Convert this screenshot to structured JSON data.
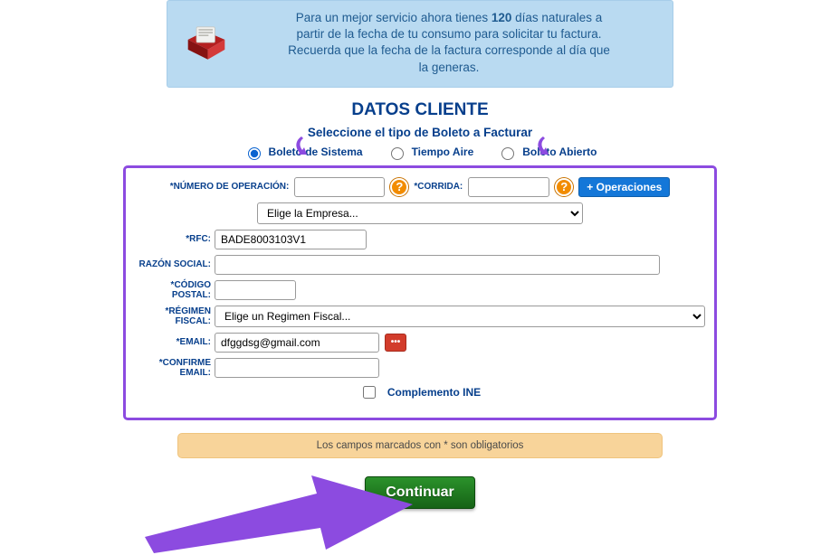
{
  "banner": {
    "line1_pre": "Para un mejor servicio ahora tienes ",
    "line1_bold": "120",
    "line1_post": " días naturales a",
    "line2": "partir de la fecha de tu consumo para solicitar tu factura.",
    "line3": "Recuerda que la fecha de la factura corresponde al día que",
    "line4": "la generas."
  },
  "titles": {
    "main": "DATOS CLIENTE",
    "subtitle": "Seleccione el tipo de Boleto a Facturar"
  },
  "ticket_types": {
    "sistema": "Boleto de Sistema",
    "tiempo_aire": "Tiempo Aire",
    "abierto": "Boleto Abierto"
  },
  "fields": {
    "numero_operacion_label": "*NÚMERO DE OPERACIÓN:",
    "corrida_label": "*CORRIDA:",
    "btn_operaciones": "+ Operaciones",
    "empresa_placeholder": "Elige la Empresa...",
    "rfc_label": "*RFC:",
    "rfc_value": "BADE8003103V1",
    "razon_label": "RAZÓN SOCIAL:",
    "cp_label": "*CÓDIGO POSTAL:",
    "regimen_label": "*RÉGIMEN FISCAL:",
    "regimen_placeholder": "Elige un Regimen Fiscal...",
    "email_label": "*EMAIL:",
    "email_value": "dfggdsg@gmail.com",
    "confirm_email_label": "*CONFIRME EMAIL:",
    "complemento_ine": "Complemento INE",
    "help_char": "?",
    "ext_char": "•••"
  },
  "footer": {
    "required_note": "Los campos marcados con * son obligatorios",
    "continue": "Continuar"
  }
}
